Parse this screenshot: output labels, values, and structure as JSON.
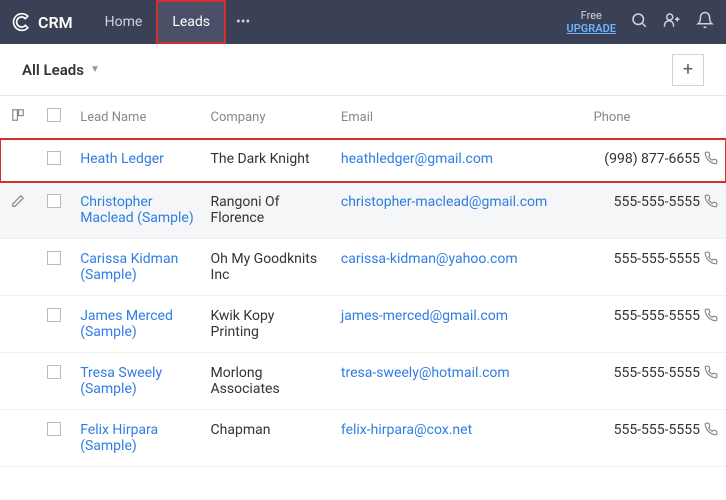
{
  "header": {
    "brand": "CRM",
    "nav": [
      "Home",
      "Leads"
    ],
    "activeIndex": 1,
    "upgrade_free": "Free",
    "upgrade_link": "UPGRADE"
  },
  "subheader": {
    "view_label": "All Leads"
  },
  "columns": [
    "Lead Name",
    "Company",
    "Email",
    "Phone"
  ],
  "rows": [
    {
      "name": "Heath Ledger",
      "company": "The Dark Knight",
      "email": "heathledger@gmail.com",
      "phone": "(998) 877-6655",
      "highlight": true
    },
    {
      "name": "Christopher Maclead (Sample)",
      "company": "Rangoni Of Florence",
      "email": "christopher-maclead@gmail.com",
      "phone": "555-555-5555",
      "hovered": true
    },
    {
      "name": "Carissa Kidman (Sample)",
      "company": "Oh My Goodknits Inc",
      "email": "carissa-kidman@yahoo.com",
      "phone": "555-555-5555"
    },
    {
      "name": "James Merced (Sample)",
      "company": "Kwik Kopy Printing",
      "email": "james-merced@gmail.com",
      "phone": "555-555-5555"
    },
    {
      "name": "Tresa Sweely (Sample)",
      "company": "Morlong Associates",
      "email": "tresa-sweely@hotmail.com",
      "phone": "555-555-5555"
    },
    {
      "name": "Felix Hirpara (Sample)",
      "company": "Chapman",
      "email": "felix-hirpara@cox.net",
      "phone": "555-555-5555"
    }
  ]
}
